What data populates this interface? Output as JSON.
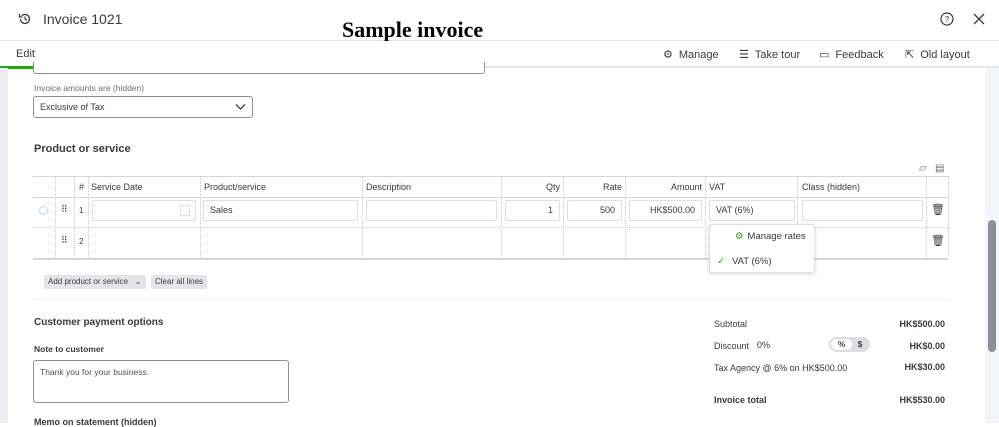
{
  "header": {
    "title": "Invoice 1021",
    "overlay_title": "Sample invoice",
    "help_icon": "help-circle-icon",
    "close_icon": "close-icon"
  },
  "tabs": [
    {
      "label": "Edit",
      "active": true
    }
  ],
  "toolbar": {
    "manage": "Manage",
    "take_tour": "Take tour",
    "feedback": "Feedback",
    "old_layout": "Old layout"
  },
  "invoice_amounts": {
    "label": "Invoice amounts are (hidden)",
    "value": "Exclusive of Tax"
  },
  "products": {
    "title": "Product or service",
    "columns": [
      "#",
      "Service Date",
      "Product/service",
      "Description",
      "Qty",
      "Rate",
      "Amount",
      "VAT",
      "Class (hidden)"
    ],
    "rows": [
      {
        "num": "1",
        "service_date": "",
        "product": "Sales",
        "description": "",
        "qty": "1",
        "rate": "500",
        "amount": "HK$500.00",
        "vat": "VAT (6%)",
        "class": ""
      },
      {
        "num": "2"
      }
    ],
    "vat_dropdown": {
      "manage_rates": "Manage rates",
      "option": "VAT (6%)"
    },
    "add_button": "Add product or service",
    "clear_button": "Clear all lines"
  },
  "payment": {
    "title": "Customer payment options",
    "note_label": "Note to customer",
    "note_value": "Thank you for your business.",
    "memo_label": "Memo on statement (hidden)"
  },
  "summary": {
    "subtotal_label": "Subtotal",
    "subtotal": "HK$500.00",
    "discount_label": "Discount",
    "discount_value": "0%",
    "toggle_percent": "%",
    "toggle_dollar": "$",
    "discount_amount": "HK$0.00",
    "tax_label": "Tax Agency @ 6% on HK$500.00",
    "tax_amount": "HK$30.00",
    "total_label": "Invoice total",
    "total": "HK$530.00"
  },
  "colors": {
    "accent_green": "#2ca01c",
    "text": "#393a3d"
  }
}
